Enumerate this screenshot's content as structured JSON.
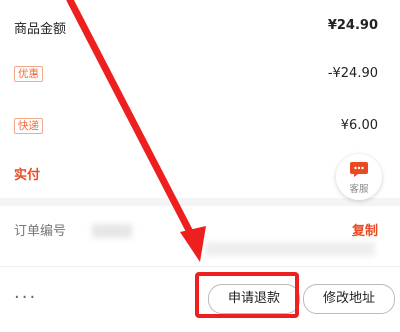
{
  "summary": {
    "goods_amount": {
      "label": "商品金额",
      "value": "¥24.90"
    },
    "discount": {
      "label": "优惠",
      "value": "-¥24.90"
    },
    "shipping": {
      "label": "快递",
      "value": "¥6.00"
    },
    "actual_paid": {
      "label": "实付"
    }
  },
  "order": {
    "number_label": "订单编号",
    "copy_label": "复制"
  },
  "floating_service": {
    "label": "客服",
    "icon": "chat-bubble-icon"
  },
  "bottom_bar": {
    "more_label": "···",
    "refund_label": "申请退款",
    "modify_address_label": "修改地址"
  },
  "annotation": {
    "color": "#ee1f1f"
  },
  "colors": {
    "accent": "#e94a23",
    "badge_border": "#f2a98a",
    "badge_text": "#ee6b3d"
  }
}
